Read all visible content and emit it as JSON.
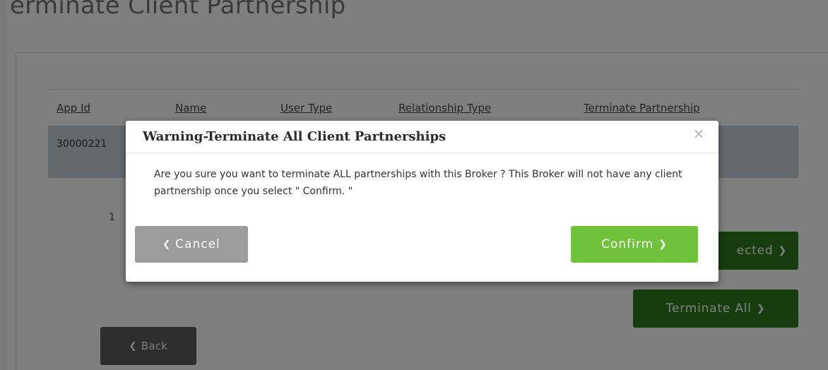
{
  "page": {
    "title": "erminate Client Partnership"
  },
  "table": {
    "headers": [
      "App Id",
      "Name",
      "User Type",
      "Relationship Type",
      "Terminate Partnership"
    ],
    "rows": [
      {
        "app_id": "30000221"
      }
    ]
  },
  "pagination": {
    "current": "1"
  },
  "actions": {
    "selected_label": "ected",
    "terminate_all_label": "Terminate All",
    "back_label": "Back"
  },
  "modal": {
    "title": "Warning-Terminate All Client Partnerships",
    "message": "Are you sure you want to terminate ALL partnerships with this Broker ? This Broker will not have any client partnership once you select \" Confirm. \"",
    "cancel_label": "Cancel",
    "confirm_label": "Confirm",
    "close_icon": "close-icon"
  },
  "colors": {
    "primary_green": "#71c23b",
    "dark_green": "#2f7a1e",
    "cancel_gray": "#9c9c9c",
    "back_gray": "#5a5a5a",
    "row_band": "#c9d3dc"
  }
}
